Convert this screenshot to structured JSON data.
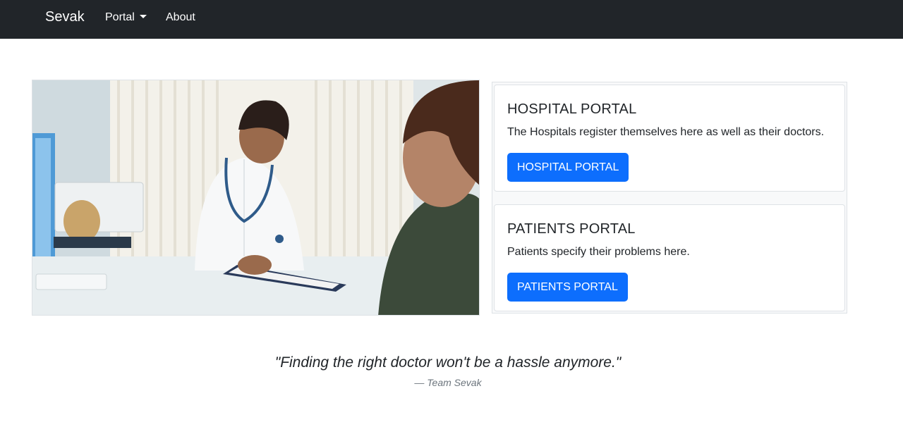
{
  "navbar": {
    "brand": "Sevak",
    "items": [
      {
        "label": "Portal",
        "has_dropdown": true
      },
      {
        "label": "About"
      }
    ]
  },
  "hero_image": {
    "alt": "doctor consultation photo"
  },
  "cards": [
    {
      "title": "HOSPITAL PORTAL",
      "text": "The Hospitals register themselves here as well as their doctors.",
      "button": "HOSPITAL PORTAL"
    },
    {
      "title": "PATIENTS PORTAL",
      "text": "Patients specify their problems here.",
      "button": "PATIENTS PORTAL"
    }
  ],
  "quote": {
    "text": "\"Finding the right doctor won't be a hassle anymore.\"",
    "author": "—  Team Sevak"
  },
  "colors": {
    "navbar_bg": "#212529",
    "primary": "#0d6efd"
  }
}
